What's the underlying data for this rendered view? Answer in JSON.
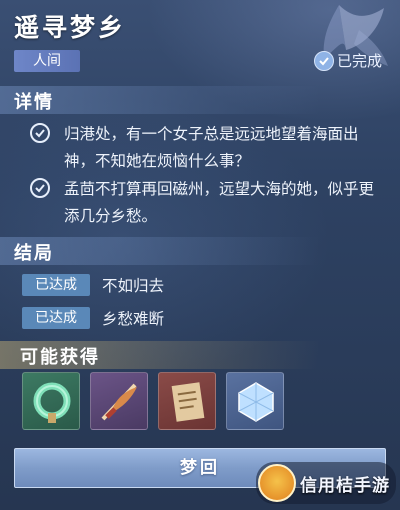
{
  "header": {
    "title": "遥寻梦乡",
    "realm_tag": "人间",
    "status": "已完成",
    "status_icon": "check-circle-icon"
  },
  "details": {
    "title": "详情",
    "items": [
      {
        "text": "归港处，有一个女子总是远远地望着海面出神，不知她在烦恼什么事？",
        "icon": "check-circle-icon"
      },
      {
        "text": "孟茴不打算再回磁州，远望大海的她，似乎更添几分乡愁。",
        "icon": "check-circle-icon"
      }
    ]
  },
  "endings": {
    "title": "结局",
    "items": [
      {
        "badge": "已达成",
        "text": "不如归去"
      },
      {
        "badge": "已达成",
        "text": "乡愁难断"
      }
    ]
  },
  "rewards": {
    "title": "可能获得",
    "items": [
      {
        "icon": "jade-ring-icon",
        "color": "#3d7a63"
      },
      {
        "icon": "feather-blade-icon",
        "color": "#6b5487"
      },
      {
        "icon": "scroll-icon",
        "color": "#8a4b48"
      },
      {
        "icon": "crystal-cube-icon",
        "color": "#5a72a0"
      }
    ]
  },
  "action": {
    "dream_label": "梦回"
  },
  "watermark": {
    "text": "信用桔手游"
  },
  "colors": {
    "background": "#2e4263",
    "badge": "#5a88b8",
    "button": "#8aa6d3"
  }
}
